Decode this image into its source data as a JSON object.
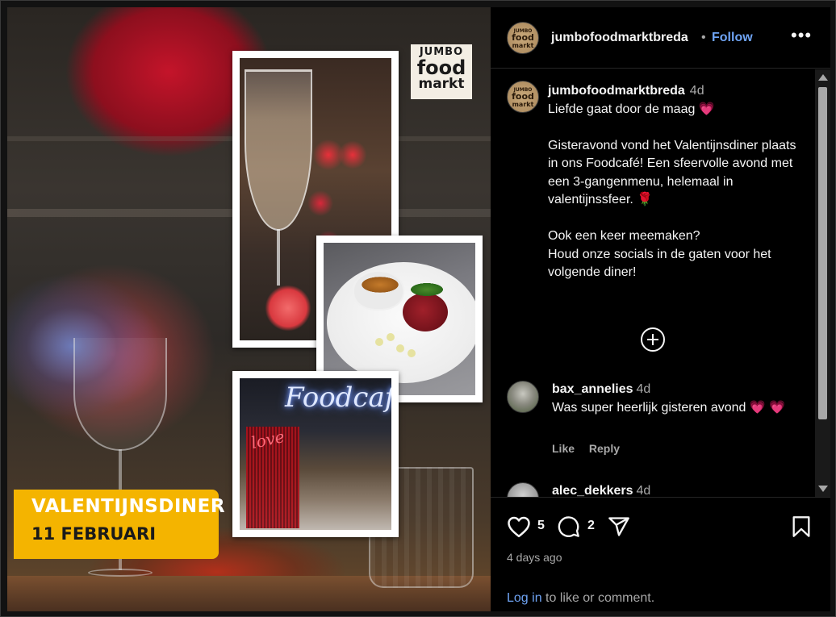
{
  "header": {
    "avatar": {
      "line1": "JUMBO",
      "line2": "food",
      "line3": "markt"
    },
    "username": "jumbofoodmarktbreda",
    "separator": "•",
    "follow_label": "Follow",
    "more_icon": "more-horizontal-icon",
    "more_label": "•••"
  },
  "media": {
    "logo": {
      "line1": "JUMBO",
      "line2": "food",
      "line3": "markt"
    },
    "banner": {
      "title": "VALENTIJNSDINER",
      "date": "11 FEBRUARI"
    },
    "neon_sign": "Foodcafé",
    "love_sign": "love"
  },
  "caption": {
    "username": "jumbofoodmarktbreda",
    "time": "4d",
    "line1": "Liefde gaat door de maag",
    "heart": "💗",
    "para2": "Gisteravond vond het Valentijnsdiner plaats in ons Foodcafé! Een sfeervolle avond met een 3-gangenmenu, helemaal in valentijnssfeer.",
    "rose": "🌹",
    "para3a": "Ook een keer meemaken?",
    "para3b": "Houd onze socials in de gaten voor het volgende diner!"
  },
  "load_more_icon": "plus-circle-icon",
  "comments": [
    {
      "username": "bax_annelies",
      "time": "4d",
      "text": "Was super heerlijk gisteren avond",
      "emoji": "💗 💗",
      "like_label": "Like",
      "reply_label": "Reply"
    },
    {
      "username": "alec_dekkers",
      "time": "4d"
    }
  ],
  "footer": {
    "likes": "5",
    "comments": "2",
    "time_ago": "4 days ago",
    "login_link": "Log in",
    "login_rest": " to like or comment."
  },
  "colors": {
    "background": "#000000",
    "link": "#6fa4f4",
    "muted": "#a8a8a8",
    "banner": "#f4b400"
  }
}
